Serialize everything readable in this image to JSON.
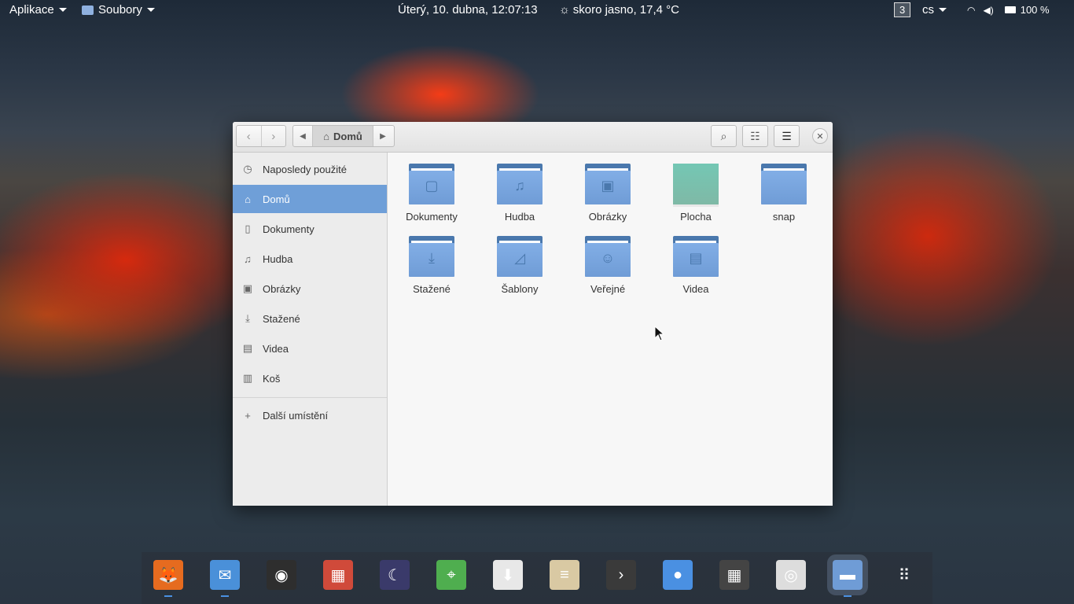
{
  "top_panel": {
    "apps_menu": "Aplikace",
    "files_menu": "Soubory",
    "clock": "Úterý, 10. dubna, 12:07:13",
    "weather": "skoro jasno, 17,4 °C",
    "workspace": "3",
    "keyboard_layout": "cs",
    "battery": "100 %"
  },
  "window": {
    "path_current": "Domů"
  },
  "sidebar": {
    "items": [
      {
        "label": "Naposledy použité",
        "icon": "clock-icon",
        "glyph": "◷"
      },
      {
        "label": "Domů",
        "icon": "home-icon",
        "glyph": "⌂"
      },
      {
        "label": "Dokumenty",
        "icon": "document-icon",
        "glyph": "▯"
      },
      {
        "label": "Hudba",
        "icon": "music-icon",
        "glyph": "♫"
      },
      {
        "label": "Obrázky",
        "icon": "image-icon",
        "glyph": "▣"
      },
      {
        "label": "Stažené",
        "icon": "download-icon",
        "glyph": "⤓"
      },
      {
        "label": "Videa",
        "icon": "film-icon",
        "glyph": "▤"
      },
      {
        "label": "Koš",
        "icon": "trash-icon",
        "glyph": "▥"
      },
      {
        "label": "Další umístění",
        "icon": "plus-icon",
        "glyph": "+"
      }
    ]
  },
  "files": [
    {
      "label": "Dokumenty",
      "icon": "document-icon",
      "glyph": "▢"
    },
    {
      "label": "Hudba",
      "icon": "music-icon",
      "glyph": "♫"
    },
    {
      "label": "Obrázky",
      "icon": "image-icon",
      "glyph": "▣"
    },
    {
      "label": "Plocha",
      "icon": "desktop-thumbnail",
      "glyph": ""
    },
    {
      "label": "snap",
      "icon": "folder-icon",
      "glyph": ""
    },
    {
      "label": "Stažené",
      "icon": "download-icon",
      "glyph": "⤓"
    },
    {
      "label": "Šablony",
      "icon": "template-icon",
      "glyph": "◿"
    },
    {
      "label": "Veřejné",
      "icon": "people-icon",
      "glyph": "☺"
    },
    {
      "label": "Videa",
      "icon": "film-icon",
      "glyph": "▤"
    }
  ],
  "dock": {
    "items": [
      {
        "name": "firefox",
        "color": "#e66b1f",
        "glyph": "🦊",
        "running": true
      },
      {
        "name": "mail",
        "color": "#4a90d9",
        "glyph": "✉",
        "running": true
      },
      {
        "name": "music-player",
        "color": "#2e2e2e",
        "glyph": "◉",
        "running": false
      },
      {
        "name": "photos",
        "color": "#d04a3a",
        "glyph": "▦",
        "running": false
      },
      {
        "name": "night-sky",
        "color": "#3a3a6a",
        "glyph": "☾",
        "running": false
      },
      {
        "name": "maps",
        "color": "#4fae4f",
        "glyph": "⌖",
        "running": false
      },
      {
        "name": "app-store",
        "color": "#e8e8e8",
        "glyph": "⬇",
        "running": false
      },
      {
        "name": "text-editor",
        "color": "#d9c9a3",
        "glyph": "≡",
        "running": false
      },
      {
        "name": "terminal",
        "color": "#3a3a3a",
        "glyph": "›",
        "running": false
      },
      {
        "name": "settings",
        "color": "#4a90e2",
        "glyph": "●",
        "running": false
      },
      {
        "name": "calculator",
        "color": "#444444",
        "glyph": "▦",
        "running": false
      },
      {
        "name": "camera",
        "color": "#dddddd",
        "glyph": "◎",
        "running": false
      },
      {
        "name": "files",
        "color": "#6f9cd6",
        "glyph": "▬",
        "running": true
      },
      {
        "name": "app-grid",
        "color": "transparent",
        "glyph": "⠿",
        "running": false
      }
    ]
  }
}
